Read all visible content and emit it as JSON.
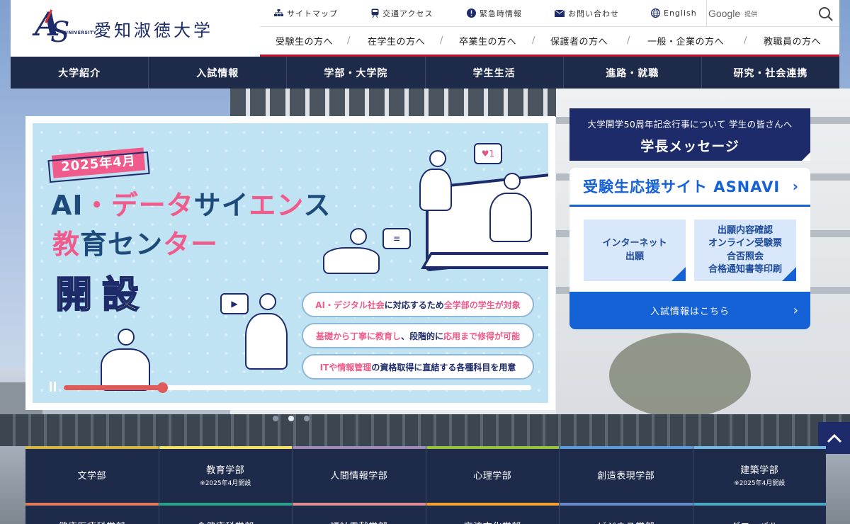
{
  "header": {
    "logo_name": "愛知淑徳大学",
    "logo_sub": "UNIVERSITY",
    "util_links": [
      {
        "label": "サイトマップ",
        "icon": "sitemap-icon"
      },
      {
        "label": "交通アクセス",
        "icon": "train-icon"
      },
      {
        "label": "緊急時情報",
        "icon": "alert-icon"
      },
      {
        "label": "お問い合わせ",
        "icon": "mail-icon"
      },
      {
        "label": "English",
        "icon": "globe-icon"
      }
    ],
    "search": {
      "provider": "Google",
      "provider_suffix": "提供",
      "placeholder": ""
    },
    "audience_links": [
      "受験生の方へ",
      "在学生の方へ",
      "卒業生の方へ",
      "保護者の方へ",
      "一般・企業の方へ",
      "教職員の方へ"
    ]
  },
  "gnav": [
    "大学紹介",
    "入試情報",
    "学部・大学院",
    "学生生活",
    "進路・就職",
    "研究・社会連携"
  ],
  "hero": {
    "date_badge": "2025年4月",
    "title_line1_a": "AI",
    "title_line1_b": "・データ",
    "title_line1_c": "サイ",
    "title_line1_d": "エン",
    "title_line1_e": "ス",
    "title_line2_a": "教",
    "title_line2_b": "育セン",
    "title_line2_c": "ター",
    "open_text": "開設",
    "pills": [
      {
        "a": "AI・デジタル社会",
        "b": "に対応するため",
        "c": "全学部の学生が対象"
      },
      {
        "a": "基礎から丁寧に教育し",
        "b": "、段階的に",
        "c": "応用まで修得が可能"
      },
      {
        "a": "ITや情報管理",
        "b": "の",
        "c": "資格取得に直結する各種科目を用意"
      }
    ],
    "bubble_like": "♥1",
    "progress": 0.21,
    "slide_count": 3,
    "active_slide": 2
  },
  "message": {
    "sub": "大学開学50周年記念行事について 学生の皆さんへ",
    "main": "学長メッセージ"
  },
  "asnavi": {
    "title": "受験生応援サイト ASNAVI",
    "box1": [
      "インターネット",
      "出願"
    ],
    "box2": [
      "出願内容確認",
      "オンライン受験票",
      "合否照会",
      "合格通知書等印刷"
    ],
    "button": "入試情報はこちら"
  },
  "faculties_row1": [
    {
      "name": "文学部",
      "note": "",
      "color": "#d4b640"
    },
    {
      "name": "教育学部",
      "note": "※2025年4月開設",
      "color": "#f2e060"
    },
    {
      "name": "人間情報学部",
      "note": "",
      "color": "#a08ab8"
    },
    {
      "name": "心理学部",
      "note": "",
      "color": "#98c23c"
    },
    {
      "name": "創造表現学部",
      "note": "",
      "color": "#5a9ad8"
    },
    {
      "name": "建築学部",
      "note": "※2025年4月開設",
      "color": "#74b8e0"
    }
  ],
  "faculties_row2": [
    {
      "name": "健康医療科学部",
      "color": "#e07a5a"
    },
    {
      "name": "食健康科学部",
      "color": "#2aa08a"
    },
    {
      "name": "福祉貢献学部",
      "color": "#e08a9a"
    },
    {
      "name": "交流文化学部",
      "color": "#f0a030"
    },
    {
      "name": "ビジネス学部",
      "color": "#6a8ac8"
    },
    {
      "name": "グローバル・",
      "color": "#4aa8c0"
    }
  ],
  "colors": {
    "navy": "#1e2a4a",
    "accent_red": "#c8102e",
    "blue": "#1562d6",
    "pink": "#f05b8b"
  }
}
